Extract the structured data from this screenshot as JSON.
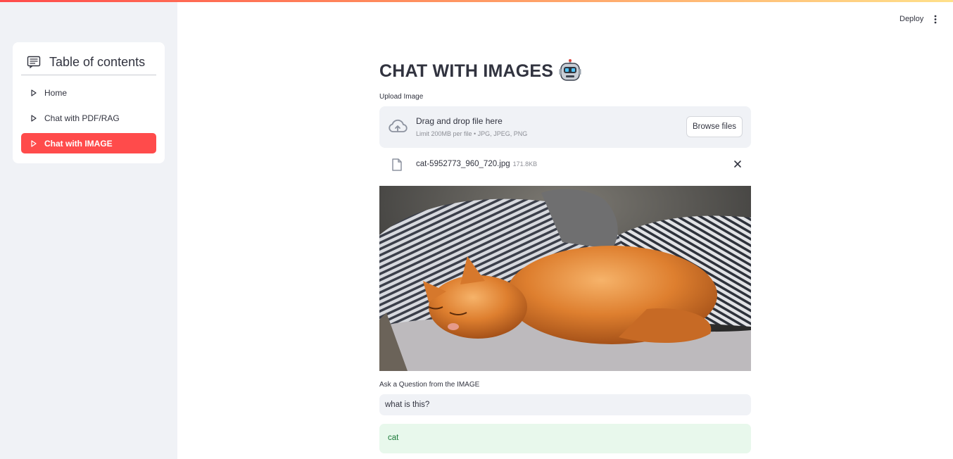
{
  "header": {
    "deploy_label": "Deploy",
    "menu_icon": "more-vertical-icon"
  },
  "sidebar": {
    "toc_title": "Table of contents",
    "toc_icon": "list-icon",
    "items": [
      {
        "label": "Home",
        "icon": "triangle-right-icon",
        "active": false
      },
      {
        "label": "Chat with PDF/RAG",
        "icon": "triangle-right-icon",
        "active": false
      },
      {
        "label": "Chat with IMAGE",
        "icon": "triangle-right-icon",
        "active": true
      }
    ],
    "accent_color": "#ff4b4b"
  },
  "main": {
    "title": "CHAT WITH IMAGES",
    "title_icon": "robot-icon",
    "upload": {
      "label": "Upload Image",
      "drop_text": "Drag and drop file here",
      "limit_text": "Limit 200MB per file • JPG, JPEG, PNG",
      "browse_label": "Browse files",
      "cloud_icon": "cloud-upload-icon"
    },
    "file": {
      "name": "cat-5952773_960_720.jpg",
      "size": "171.8KB",
      "icon": "file-icon",
      "close_icon": "close-icon"
    },
    "image": {
      "subject": "orange cat sleeping on striped bedding"
    },
    "question": {
      "label": "Ask a Question from the IMAGE",
      "value": "what is this?"
    },
    "answer": {
      "text": "cat",
      "bg_color": "#e8f8ec",
      "text_color": "#1b7a39"
    }
  }
}
